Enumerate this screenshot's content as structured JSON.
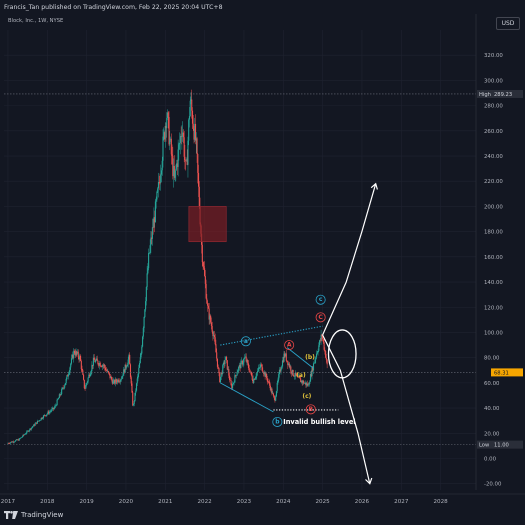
{
  "header": {
    "publisher_line": "Francis_Tan published on TradingView.com, Feb 22, 2025 20:04 UTC+8",
    "symbol_line": "Block, Inc., 1W, NYSE",
    "currency_label": "USD"
  },
  "footer": {
    "brand": "TradingView"
  },
  "price_tags": {
    "high_label": "High",
    "high_value": "289.23",
    "last_value": "68.31",
    "low_label": "Low",
    "low_value": "11.00"
  },
  "annotations": {
    "invalid_level": "Invalid bullish level"
  },
  "colors": {
    "background": "#131722",
    "candle_up": "#26a69a",
    "candle_down": "#ef5350",
    "wave_blue": "#2aa3c9",
    "wave_red": "#e84646",
    "wave_yellow": "#e0c23a",
    "projection": "#ffffff",
    "box_fill": "#7a1e24"
  },
  "chart_data": {
    "type": "candlestick",
    "title": "Block, Inc., 1W, NYSE",
    "xlabel": "",
    "ylabel": "USD",
    "ylim": [
      -25,
      340
    ],
    "xlim": [
      2016.9,
      2028.9
    ],
    "grid": true,
    "x_ticks": [
      "2017",
      "2018",
      "2019",
      "2020",
      "2021",
      "2022",
      "2023",
      "2024",
      "2025",
      "2026",
      "2027",
      "2028"
    ],
    "y_ticks": [
      "-20.00",
      "0.00",
      "20.00",
      "40.00",
      "60.00",
      "80.00",
      "100.00",
      "120.00",
      "140.00",
      "160.00",
      "180.00",
      "200.00",
      "220.00",
      "240.00",
      "260.00",
      "280.00",
      "300.00",
      "320.00"
    ],
    "all_time_high": 289.23,
    "last_price": 68.31,
    "low": 11.0,
    "invalid_level": 38.5,
    "price_path": [
      [
        2017.0,
        12
      ],
      [
        2017.3,
        15
      ],
      [
        2017.6,
        24
      ],
      [
        2017.9,
        33
      ],
      [
        2018.2,
        40
      ],
      [
        2018.5,
        62
      ],
      [
        2018.7,
        85
      ],
      [
        2018.85,
        80
      ],
      [
        2018.97,
        55
      ],
      [
        2019.2,
        78
      ],
      [
        2019.45,
        74
      ],
      [
        2019.7,
        60
      ],
      [
        2019.9,
        64
      ],
      [
        2020.1,
        80
      ],
      [
        2020.2,
        40
      ],
      [
        2020.4,
        82
      ],
      [
        2020.6,
        160
      ],
      [
        2020.85,
        215
      ],
      [
        2021.05,
        275
      ],
      [
        2021.25,
        220
      ],
      [
        2021.45,
        265
      ],
      [
        2021.55,
        225
      ],
      [
        2021.65,
        285
      ],
      [
        2021.8,
        250
      ],
      [
        2021.95,
        165
      ],
      [
        2022.1,
        118
      ],
      [
        2022.25,
        98
      ],
      [
        2022.4,
        62
      ],
      [
        2022.55,
        80
      ],
      [
        2022.7,
        56
      ],
      [
        2022.85,
        70
      ],
      [
        2023.05,
        80
      ],
      [
        2023.25,
        62
      ],
      [
        2023.45,
        74
      ],
      [
        2023.65,
        60
      ],
      [
        2023.8,
        46
      ],
      [
        2023.92,
        68
      ],
      [
        2024.05,
        83
      ],
      [
        2024.25,
        68
      ],
      [
        2024.45,
        62
      ],
      [
        2024.65,
        58
      ],
      [
        2024.85,
        82
      ],
      [
        2025.0,
        98
      ],
      [
        2025.12,
        78
      ],
      [
        2025.15,
        68.31
      ]
    ],
    "box": {
      "x": [
        2021.6,
        2022.55
      ],
      "y": [
        172,
        200
      ]
    },
    "trend_lines": [
      {
        "from": [
          2022.4,
          90
        ],
        "to": [
          2025.0,
          105
        ],
        "style": "dotted",
        "color": "wave_blue"
      },
      {
        "from": [
          2022.4,
          60
        ],
        "to": [
          2023.75,
          37
        ],
        "style": "solid",
        "color": "wave_blue"
      },
      {
        "from": [
          2024.1,
          88
        ],
        "to": [
          2024.75,
          72
        ],
        "style": "solid",
        "color": "wave_blue"
      },
      {
        "from": [
          2023.75,
          38.5
        ],
        "to": [
          2025.4,
          38.5
        ],
        "style": "dotted",
        "color": "projection"
      }
    ],
    "projections": [
      {
        "path": [
          [
            2025.0,
            98
          ],
          [
            2025.6,
            140
          ],
          [
            2026.0,
            180
          ],
          [
            2026.35,
            218
          ]
        ],
        "direction": "up"
      },
      {
        "path": [
          [
            2025.0,
            98
          ],
          [
            2025.45,
            70
          ],
          [
            2025.9,
            20
          ],
          [
            2026.2,
            -20
          ]
        ],
        "direction": "down"
      }
    ],
    "ellipse": {
      "center": [
        2025.5,
        83
      ],
      "rx_years": 0.35,
      "ry_price": 19
    },
    "wave_labels": [
      {
        "text": "a",
        "x": 2023.05,
        "y": 93,
        "color": "wave_blue",
        "style": "circle"
      },
      {
        "text": "b",
        "x": 2023.85,
        "y": 29,
        "color": "wave_blue",
        "style": "circle"
      },
      {
        "text": "c",
        "x": 2024.95,
        "y": 126,
        "color": "wave_blue",
        "style": "circle"
      },
      {
        "text": "A",
        "x": 2024.15,
        "y": 90,
        "color": "wave_red",
        "style": "circle"
      },
      {
        "text": "B",
        "x": 2024.7,
        "y": 39,
        "color": "wave_red",
        "style": "circle"
      },
      {
        "text": "C",
        "x": 2024.95,
        "y": 112,
        "color": "wave_red",
        "style": "circle"
      },
      {
        "text": "(a)",
        "x": 2024.45,
        "y": 66,
        "color": "wave_yellow",
        "style": "text"
      },
      {
        "text": "(b)",
        "x": 2024.68,
        "y": 80,
        "color": "wave_yellow",
        "style": "text"
      },
      {
        "text": "(c)",
        "x": 2024.6,
        "y": 49,
        "color": "wave_yellow",
        "style": "text"
      }
    ]
  }
}
